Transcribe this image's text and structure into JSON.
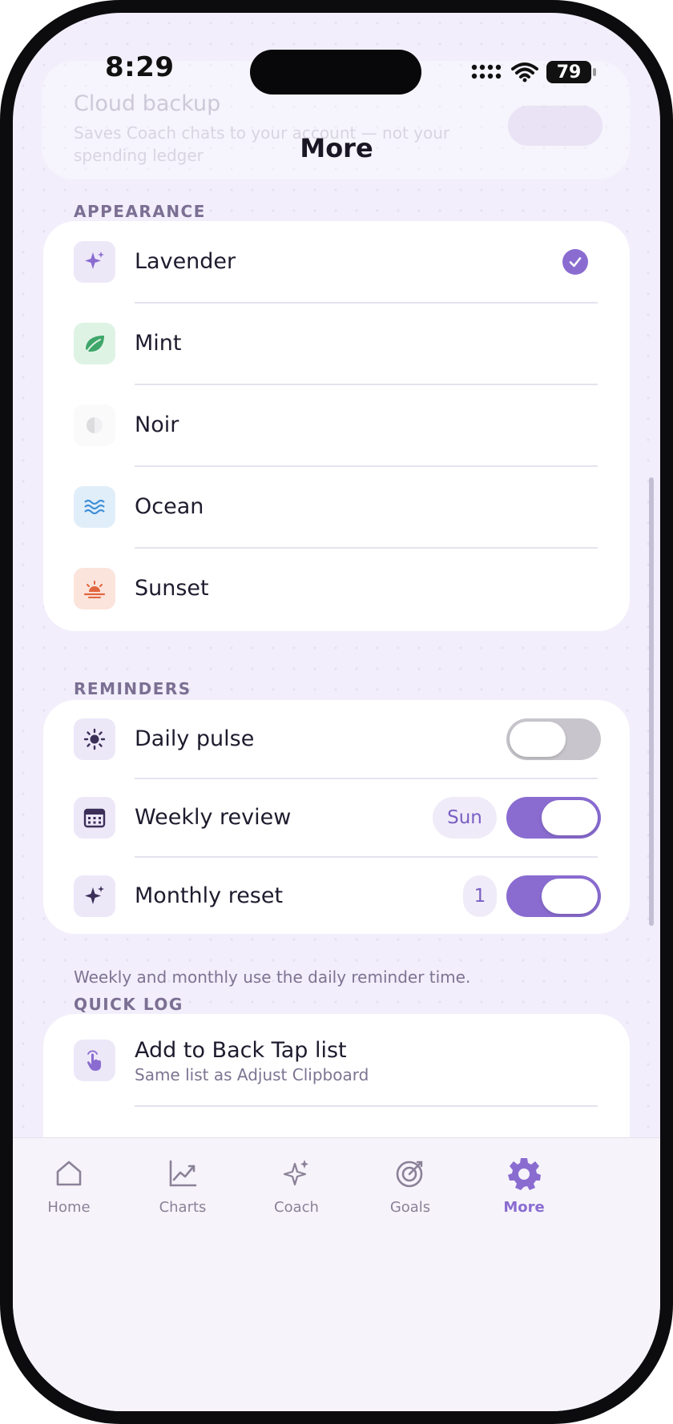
{
  "status_bar": {
    "time": "8:29",
    "battery": "79"
  },
  "background_card": {
    "title": "Cloud backup",
    "subtitle": "Saves Coach chats to your account — not your spending ledger"
  },
  "header": {
    "title": "More"
  },
  "appearance": {
    "section_label": "APPEARANCE",
    "selected": "Lavender",
    "themes": [
      {
        "label": "Lavender",
        "icon": "sparkle-icon",
        "color": "#8a6cd1"
      },
      {
        "label": "Mint",
        "icon": "leaf-icon",
        "color": "#3fa66a"
      },
      {
        "label": "Noir",
        "icon": "half-moon-icon",
        "color": "#d8d8da"
      },
      {
        "label": "Ocean",
        "icon": "waves-icon",
        "color": "#3d8fd8"
      },
      {
        "label": "Sunset",
        "icon": "sunset-icon",
        "color": "#e0663e"
      }
    ]
  },
  "reminders": {
    "section_label": "REMINDERS",
    "items": [
      {
        "label": "Daily pulse",
        "icon": "sun-icon",
        "enabled": false
      },
      {
        "label": "Weekly review",
        "icon": "calendar-icon",
        "badge": "Sun",
        "enabled": true
      },
      {
        "label": "Monthly reset",
        "icon": "sparkle-icon",
        "badge": "1",
        "enabled": true
      }
    ],
    "footnote": "Weekly and monthly use the daily reminder time."
  },
  "quick_log": {
    "section_label": "QUICK LOG",
    "items": [
      {
        "label": "Add to Back Tap list",
        "sublabel": "Same list as Adjust Clipboard",
        "icon": "tap-hand-icon"
      }
    ]
  },
  "tab_bar": {
    "active": "More",
    "tabs": [
      {
        "label": "Home",
        "icon": "home-icon"
      },
      {
        "label": "Charts",
        "icon": "chart-line-icon"
      },
      {
        "label": "Coach",
        "icon": "sparkle-icon"
      },
      {
        "label": "Goals",
        "icon": "target-icon"
      },
      {
        "label": "More",
        "icon": "gear-icon"
      }
    ]
  },
  "colors": {
    "accent": "#8a6cd1",
    "background": "#f2eefb",
    "card": "#ffffff",
    "toggle_off": "#c8c6cc"
  }
}
